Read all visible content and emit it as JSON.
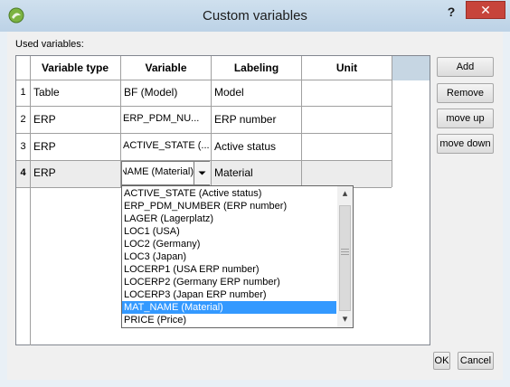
{
  "window": {
    "title": "Custom variables",
    "help_label": "?",
    "close_label": "✕"
  },
  "used_variables_label": "Used variables:",
  "table": {
    "headers": [
      "Variable type",
      "Variable",
      "Labeling",
      "Unit"
    ],
    "rows": [
      {
        "num": "1",
        "type": "Table",
        "variable": "BF (Model)",
        "labeling": "Model",
        "unit": ""
      },
      {
        "num": "2",
        "type": "ERP",
        "variable": "ERP_PDM_NU...",
        "labeling": "ERP number",
        "unit": ""
      },
      {
        "num": "3",
        "type": "ERP",
        "variable": "ACTIVE_STATE (...",
        "labeling": "Active status",
        "unit": ""
      },
      {
        "num": "4",
        "type": "ERP",
        "variable": "MAT_NAME (Material)",
        "labeling": "Material",
        "unit": ""
      }
    ]
  },
  "buttons": {
    "add": "Add",
    "remove": "Remove",
    "move_up": "move up",
    "move_down": "move down",
    "ok": "OK",
    "cancel": "Cancel"
  },
  "dropdown": {
    "options": [
      "ACTIVE_STATE (Active status)",
      "ERP_PDM_NUMBER (ERP number)",
      "LAGER (Lagerplatz)",
      "LOC1 (USA)",
      "LOC2 (Germany)",
      "LOC3 (Japan)",
      "LOCERP1 (USA ERP number)",
      "LOCERP2 (Germany ERP number)",
      "LOCERP3 (Japan ERP number)",
      "MAT_NAME (Material)",
      "PRICE (Price)"
    ],
    "selected_index": 9,
    "scroll_up_icon": "▴",
    "scroll_down_icon": "▾"
  }
}
